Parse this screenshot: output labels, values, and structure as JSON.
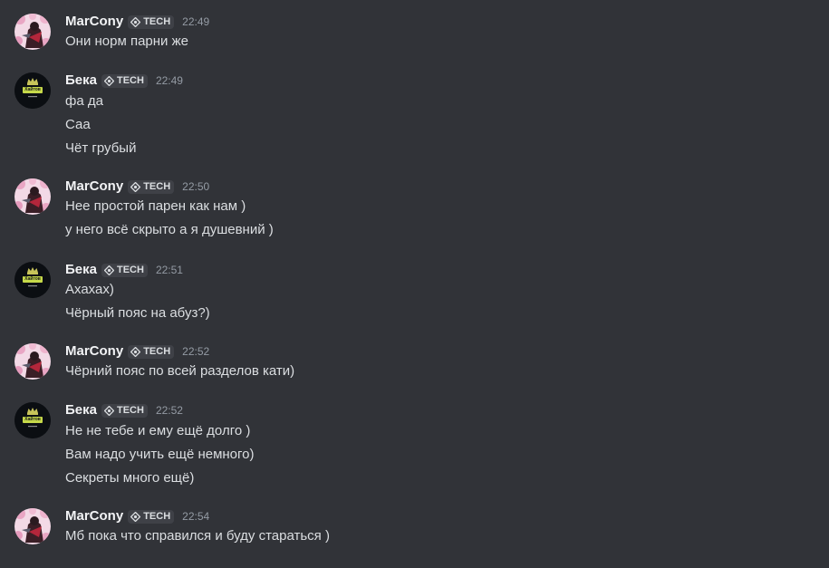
{
  "tag_label": "TECH",
  "colors": {
    "background": "#313338",
    "username": "#f2f3f5",
    "message_text": "#dbdee1",
    "timestamp": "#949ba4",
    "tag_background": "#3f4147"
  },
  "messages": [
    {
      "author": "MarCony",
      "avatar": "marcony-avatar",
      "time": "22:49",
      "lines": [
        "Они норм парни же"
      ]
    },
    {
      "author": "Бека",
      "avatar": "beka-avatar",
      "avatar_text": "Хайтов",
      "time": "22:49",
      "lines": [
        "фа да",
        "Саа",
        "Чёт грубый"
      ]
    },
    {
      "author": "MarCony",
      "avatar": "marcony-avatar",
      "time": "22:50",
      "lines": [
        "Нее простой парен как нам )",
        "у него всё скрыто а я душевний )"
      ]
    },
    {
      "author": "Бека",
      "avatar": "beka-avatar",
      "avatar_text": "Хайтов",
      "time": "22:51",
      "lines": [
        "Ахахах)",
        "Чёрный пояс на абуз?)"
      ]
    },
    {
      "author": "MarCony",
      "avatar": "marcony-avatar",
      "time": "22:52",
      "lines": [
        "Чёрний пояс по всей разделов кати)"
      ]
    },
    {
      "author": "Бека",
      "avatar": "beka-avatar",
      "avatar_text": "Хайтов",
      "time": "22:52",
      "lines": [
        "Не не тебе и ему ещё долго )",
        "Вам надо учить ещё немного)",
        "Секреты много ещё)"
      ]
    },
    {
      "author": "MarCony",
      "avatar": "marcony-avatar",
      "time": "22:54",
      "lines": [
        "Мб пока что справился и буду стараться )"
      ]
    }
  ]
}
